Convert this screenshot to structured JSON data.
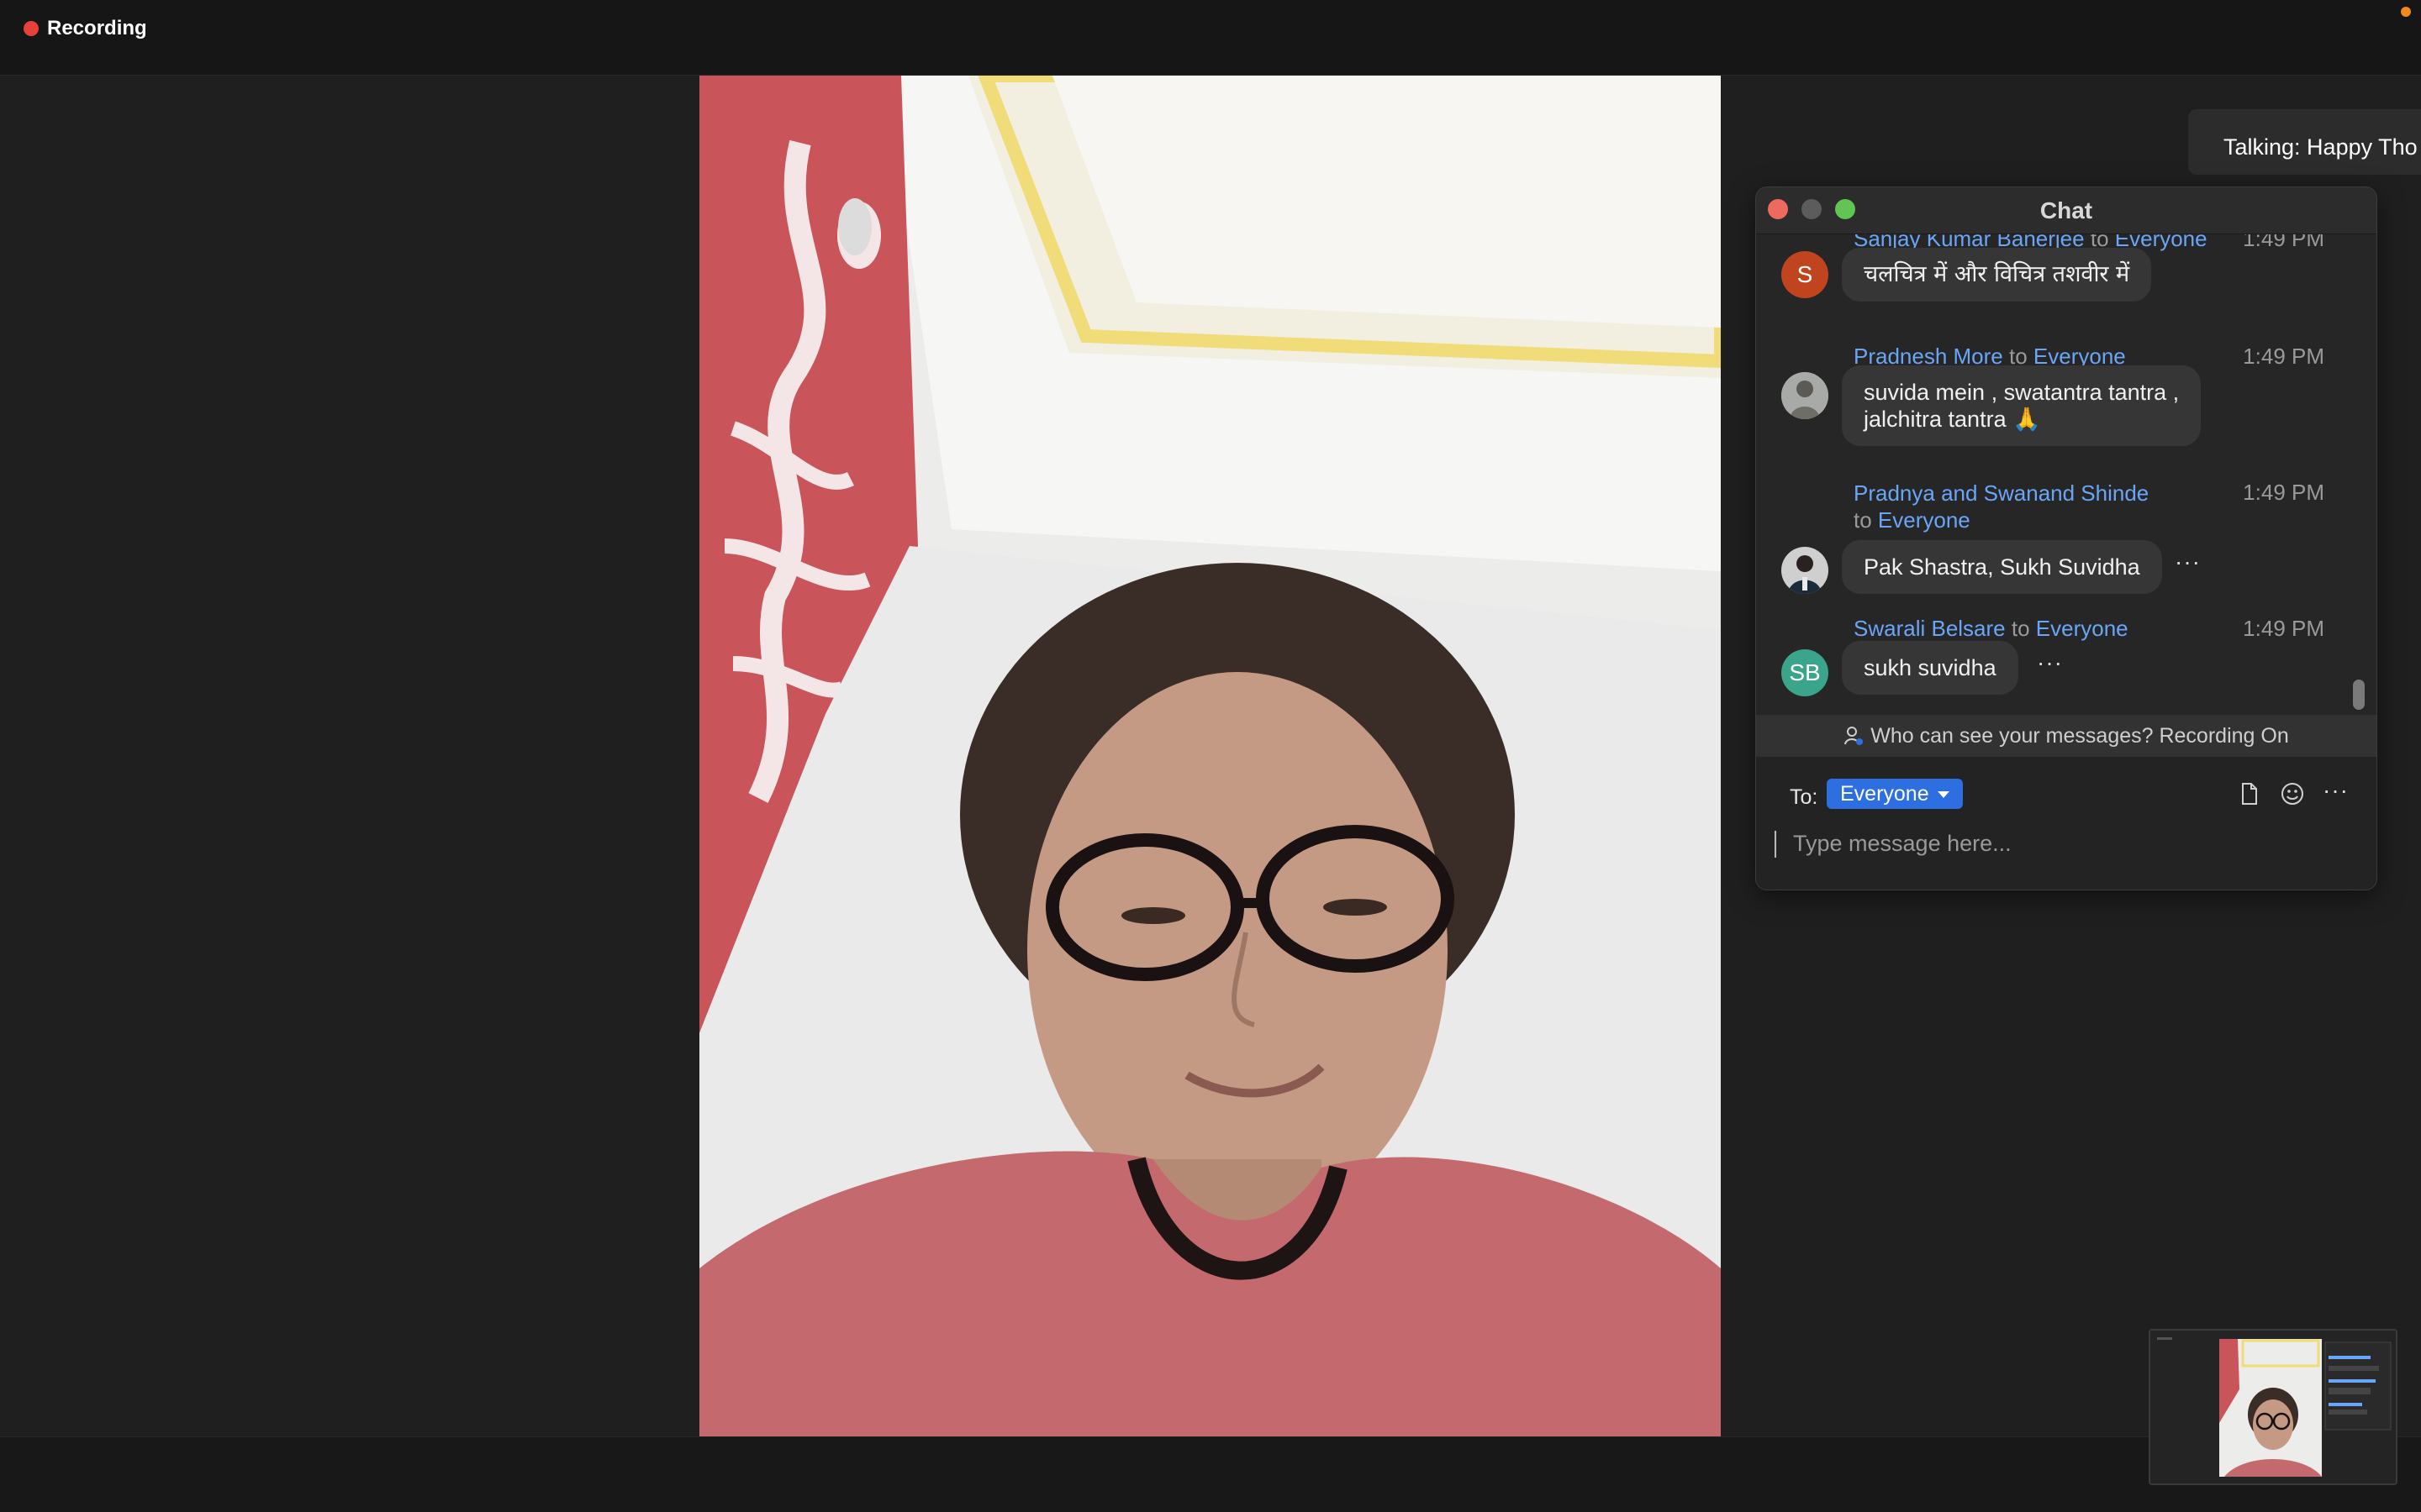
{
  "recording": {
    "label": "Recording"
  },
  "talking": {
    "label": "Talking: Happy Tho"
  },
  "chat": {
    "title": "Chat",
    "messages": [
      {
        "sender": "Sanjay Kumar Banerjee",
        "to_word": "to",
        "recipient": "Everyone",
        "time": "1:49 PM",
        "text": "चलचित्र में और विचित्र तशवीर में",
        "avatar_initials": "S",
        "avatar_color": "#c0451f"
      },
      {
        "sender": "Pradnesh More",
        "to_word": "to",
        "recipient": "Everyone",
        "time": "1:49 PM",
        "text_line1": "suvida mein , swatantra tantra ,",
        "text_line2": "jalchitra tantra 🙏"
      },
      {
        "sender": "Pradnya and Swanand Shinde",
        "to_word": "to",
        "recipient": "Everyone",
        "time": "1:49 PM",
        "text": "Pak Shastra, Sukh Suvidha",
        "more": "···"
      },
      {
        "sender": "Swarali Belsare",
        "to_word": "to",
        "recipient": "Everyone",
        "time": "1:49 PM",
        "text": "sukh suvidha",
        "avatar_initials": "SB",
        "avatar_color": "#3aa58a",
        "more": "···"
      }
    ],
    "privacy_notice": "Who can see your messages? Recording On",
    "compose": {
      "to_label": "To:",
      "recipient": "Everyone",
      "placeholder": "Type message here...",
      "more": "···"
    }
  },
  "colors": {
    "accent_blue": "#2d6fe0",
    "sender_blue": "#6aa6f8",
    "recording_red": "#e8413c"
  }
}
